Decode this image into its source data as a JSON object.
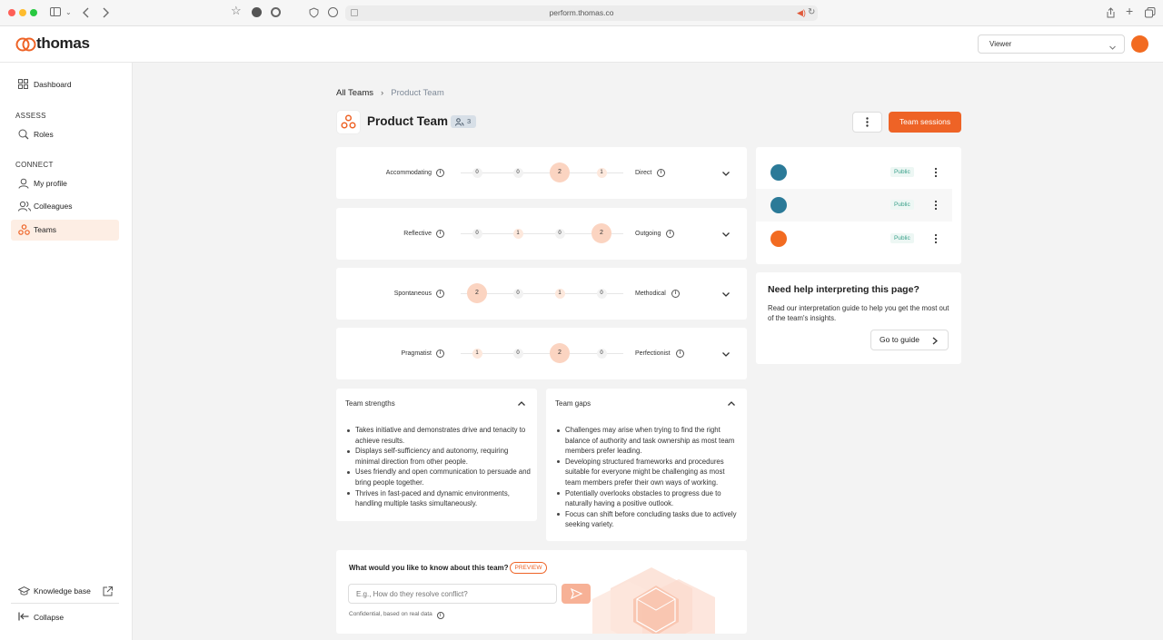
{
  "browser": {
    "url": "perform.thomas.co"
  },
  "header": {
    "brand": "thomas",
    "role_select": {
      "value": "Viewer"
    }
  },
  "sidebar": {
    "dashboard": "Dashboard",
    "assess_heading": "ASSESS",
    "roles": "Roles",
    "connect_heading": "CONNECT",
    "my_profile": "My profile",
    "colleagues": "Colleagues",
    "teams": "Teams",
    "knowledge_base": "Knowledge base",
    "collapse": "Collapse"
  },
  "breadcrumb": {
    "root": "All Teams",
    "current": "Product Team"
  },
  "team": {
    "name": "Product Team",
    "member_count": "3",
    "sessions_button": "Team sessions"
  },
  "traits": [
    {
      "left": "Accommodating",
      "right": "Direct",
      "values": [
        "0",
        "0",
        "2",
        "1"
      ]
    },
    {
      "left": "Reflective",
      "right": "Outgoing",
      "values": [
        "0",
        "1",
        "0",
        "2"
      ]
    },
    {
      "left": "Spontaneous",
      "right": "Methodical",
      "values": [
        "2",
        "0",
        "1",
        "0"
      ]
    },
    {
      "left": "Pragmatist",
      "right": "Perfectionist",
      "values": [
        "1",
        "0",
        "2",
        "0"
      ]
    }
  ],
  "strengths": {
    "title": "Team strengths",
    "items": [
      "Takes initiative and demonstrates drive and tenacity to achieve results.",
      "Displays self-sufficiency and autonomy, requiring minimal direction from other people.",
      "Uses friendly and open communication to persuade and bring people together.",
      "Thrives in fast-paced and dynamic environments, handling multiple tasks simultaneously."
    ]
  },
  "gaps": {
    "title": "Team gaps",
    "items": [
      "Challenges may arise when trying to find the right balance of authority and task ownership as most team members prefer leading.",
      "Developing structured frameworks and procedures suitable for everyone might be challenging as most team members prefer their own ways of working.",
      "Potentially overlooks obstacles to progress due to naturally having a positive outlook.",
      "Focus can shift before concluding tasks due to actively seeking variety."
    ]
  },
  "ask": {
    "question": "What would you like to know about this team?",
    "badge": "PREVIEW",
    "placeholder": "E.g., How do they resolve conflict?",
    "footnote": "Confidential, based on real data"
  },
  "members": [
    {
      "visibility": "Public",
      "avatar_color": "#2b7a98"
    },
    {
      "visibility": "Public",
      "avatar_color": "#2b7a98"
    },
    {
      "visibility": "Public",
      "avatar_color": "#f26b21"
    }
  ],
  "help": {
    "title": "Need help interpreting this page?",
    "text": "Read our interpretation guide to help you get the most out of the team's insights.",
    "button": "Go to guide"
  }
}
